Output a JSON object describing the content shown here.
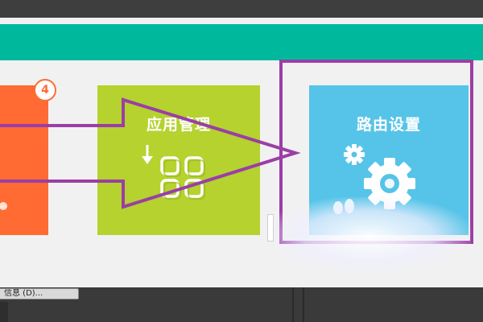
{
  "tiles": {
    "orange": {
      "badge": "4",
      "color": "#ff6b33"
    },
    "green": {
      "title": "应用管理",
      "color": "#b5d22f"
    },
    "blue": {
      "title": "路由设置",
      "color": "#56c4e8"
    }
  },
  "header": {
    "color": "#00b99d"
  },
  "annotation": {
    "color": "#9b3ea6"
  },
  "bottom_bar": {
    "button_label": "信息 (D)..."
  }
}
